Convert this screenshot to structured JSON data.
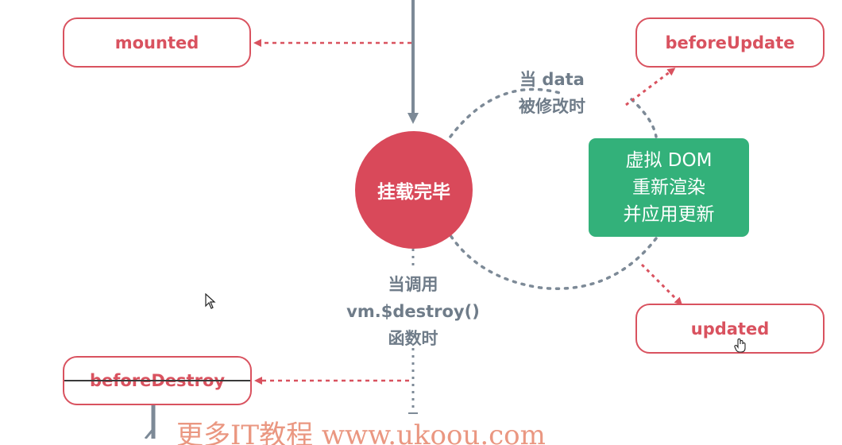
{
  "hooks": {
    "mounted": "mounted",
    "before_update": "beforeUpdate",
    "updated": "updated",
    "before_destroy": "beforeDestroy"
  },
  "mount_complete": "挂载完毕",
  "data_changed": [
    "当 data",
    "被修改时"
  ],
  "vdom_rerender": [
    "虚拟 DOM",
    "重新渲染",
    "并应用更新"
  ],
  "destroy_call": [
    "当调用",
    "vm.$destroy()",
    "函数时"
  ],
  "watermark_text": "更多IT教程 www.ukoou.com",
  "colors": {
    "hook_red": "#d9525f",
    "circle_red": "#d9495a",
    "green": "#33b17a",
    "slate": "#7d8a97"
  }
}
